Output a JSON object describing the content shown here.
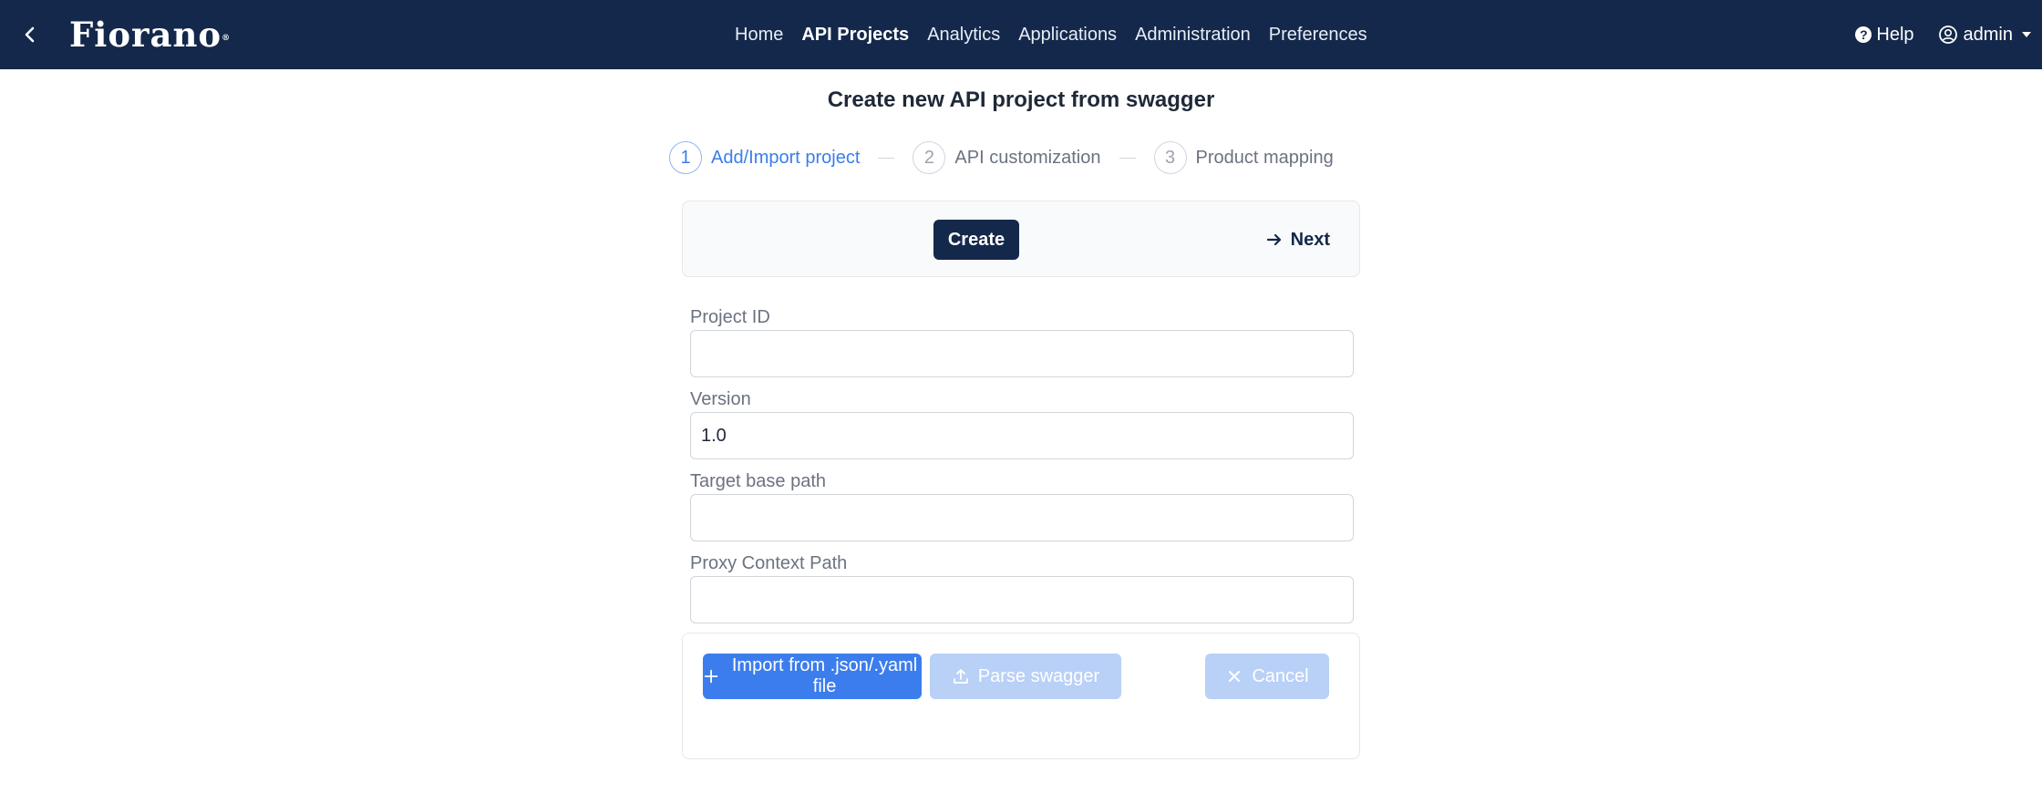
{
  "header": {
    "logo_text": "Fiorano",
    "nav": [
      "Home",
      "API Projects",
      "Analytics",
      "Applications",
      "Administration",
      "Preferences"
    ],
    "active_nav": "API Projects",
    "help_label": "Help",
    "user_label": "admin"
  },
  "page": {
    "title": "Create new API project from swagger"
  },
  "steps": [
    {
      "number": "1",
      "label": "Add/Import project",
      "active": true
    },
    {
      "number": "2",
      "label": "API customization",
      "active": false
    },
    {
      "number": "3",
      "label": "Product mapping",
      "active": false
    }
  ],
  "actions": {
    "create_label": "Create",
    "next_label": "Next"
  },
  "form": {
    "project_id": {
      "label": "Project ID",
      "value": ""
    },
    "version": {
      "label": "Version",
      "value": "1.0"
    },
    "target_base_path": {
      "label": "Target base path",
      "value": ""
    },
    "proxy_context_path": {
      "label": "Proxy Context Path",
      "value": ""
    }
  },
  "import": {
    "import_label": "Import from .json/.yaml file",
    "parse_label": "Parse swagger",
    "cancel_label": "Cancel"
  },
  "colors": {
    "header_bg": "#14284b",
    "accent": "#3b7ded",
    "disabled_button": "#b9d0f7"
  },
  "icons": {
    "back": "chevron-left-icon",
    "help": "question-circle-icon",
    "user": "user-circle-icon",
    "next": "arrow-right-icon",
    "import": "plus-icon",
    "parse": "upload-icon",
    "cancel": "close-icon"
  }
}
